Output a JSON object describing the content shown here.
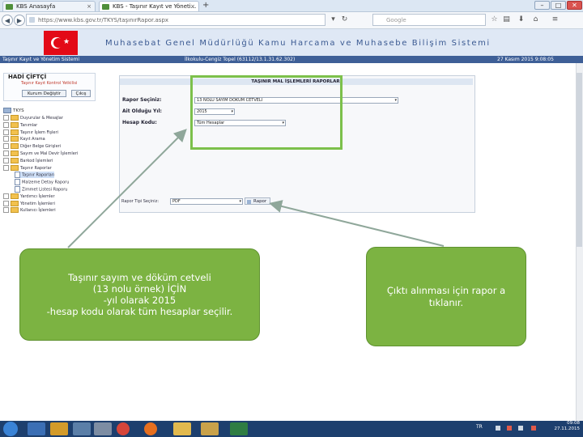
{
  "browser": {
    "tabs": [
      {
        "label": "KBS Anasayfa"
      },
      {
        "label": "KBS - Taşınır Kayıt ve Yöneti..."
      }
    ],
    "new_tab_label": "+",
    "url": "https://www.kbs.gov.tr/TKYS/taşınırRapor.aspx",
    "search_placeholder": "Google",
    "window_buttons": {
      "minimize": "–",
      "maximize": "□",
      "close": "✕"
    }
  },
  "header": {
    "title": "Muhasebat Genel Müdürlüğü Kamu Harcama ve Muhasebe Bilişim Sistemi",
    "subbar_left": "Taşınır Kayıt ve Yönetim Sistemi",
    "subbar_center": "İlkokulu-Cengiz Topel (63112/13.1.31.62.302)",
    "subbar_right": "27 Kasım 2015 9:08:05"
  },
  "user": {
    "name": "HADİ ÇİFTÇİ",
    "role": "Taşınır Kayıt Kontrol Yetkilisi",
    "change_role_label": "Kurum Değiştir",
    "logout_label": "Çıkış"
  },
  "tree": {
    "root_label": "TKYS",
    "items": [
      {
        "label": "Duyurular & Mesajlar",
        "type": "folder",
        "expanded": false
      },
      {
        "label": "Tanımlar",
        "type": "folder",
        "expanded": false
      },
      {
        "label": "Taşınır İşlem Fişleri",
        "type": "folder",
        "expanded": false
      },
      {
        "label": "Kayıt Arama",
        "type": "folder",
        "expanded": false
      },
      {
        "label": "Diğer Belge Girişleri",
        "type": "folder",
        "expanded": false
      },
      {
        "label": "Sayım ve Mal Devir İşlemleri",
        "type": "folder",
        "expanded": false
      },
      {
        "label": "Barkod İşlemleri",
        "type": "folder",
        "expanded": false
      },
      {
        "label": "Taşınır Raporlar",
        "type": "folder",
        "expanded": true
      },
      {
        "label": "Taşınır Raporları",
        "type": "doc",
        "selected": true
      },
      {
        "label": "Malzeme Detay Raporu",
        "type": "doc"
      },
      {
        "label": "Zimmet Listesi Raporu",
        "type": "doc"
      },
      {
        "label": "Yardımcı İşlemler",
        "type": "folder",
        "expanded": false
      },
      {
        "label": "Yönetim İşlemleri",
        "type": "folder",
        "expanded": false
      },
      {
        "label": "Kullanıcı İşlemleri",
        "type": "folder",
        "expanded": false
      }
    ]
  },
  "form": {
    "title": "TAŞINIR MAL İŞLEMLERİ RAPORLARI",
    "report_label": "Rapor Seçiniz:",
    "report_value": "13 NOLU SAYIM DÖKÜM CETVELİ",
    "year_label": "Ait Olduğu Yıl:",
    "year_value": "2015",
    "account_label": "Hesap Kodu:",
    "account_value": "Tüm Hesaplar",
    "output_label": "Rapor Tipi Seçiniz:",
    "output_value": "PDF",
    "report_button_label": "Rapor"
  },
  "callouts": {
    "left_lines": [
      "Taşınır sayım ve döküm cetveli",
      "(13 nolu örnek) İÇİN",
      "-yıl olarak 2015",
      "-hesap kodu olarak tüm hesaplar seçilir."
    ],
    "right_lines": [
      "Çıktı alınması için  rapor a",
      "tıklanır."
    ]
  },
  "taskbar": {
    "time": "09:08",
    "date": "27.11.2015",
    "tray_label": "TR"
  },
  "colors": {
    "callout_green": "#7cb342",
    "highlight_green": "#7cc04b",
    "header_blue": "#3e5f97",
    "arrow_gray": "#8fa79a"
  }
}
